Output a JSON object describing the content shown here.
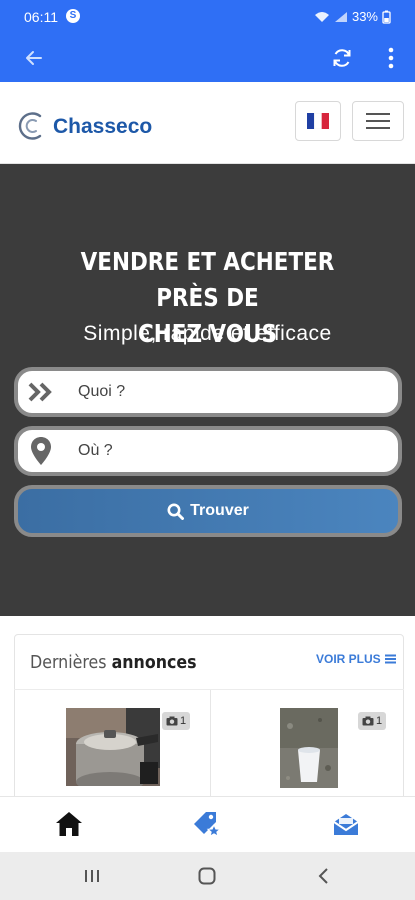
{
  "status_bar": {
    "time": "06:11",
    "notification_glyph": "S",
    "battery": "33%"
  },
  "app_bar": {
    "back_icon": "arrow-left-icon",
    "refresh_icon": "refresh-icon",
    "more_icon": "more-vert-icon"
  },
  "header": {
    "brand": "Chasseco",
    "language_flag": "france-flag-icon",
    "menu_icon": "hamburger-icon"
  },
  "hero": {
    "title_line1": "VENDRE ET ACHETER PRÈS DE",
    "title_line2": "CHEZ VOUS",
    "subtitle": "Simple, rapide et efficace",
    "what_placeholder": "Quoi ?",
    "where_placeholder": "Où ?",
    "search_button": "Trouver"
  },
  "listings": {
    "heading_light": "Dernières",
    "heading_bold": "annonces",
    "see_more": "VOIR PLUS",
    "items": [
      {
        "photo_count": "1",
        "image": "pressure-cooker-photo"
      },
      {
        "photo_count": "1",
        "image": "cup-on-ground-photo"
      }
    ]
  },
  "bottom_nav": {
    "items": [
      "home-icon",
      "sell-tag-icon",
      "messages-icon"
    ]
  },
  "system_nav": {
    "items": [
      "recent-apps-icon",
      "home-button-icon",
      "back-button-icon"
    ]
  },
  "colors": {
    "app_bar": "#2f6ff5",
    "brand": "#1d58a8",
    "hero_bg": "#3c3c3c",
    "accent": "#3b7bd8"
  }
}
